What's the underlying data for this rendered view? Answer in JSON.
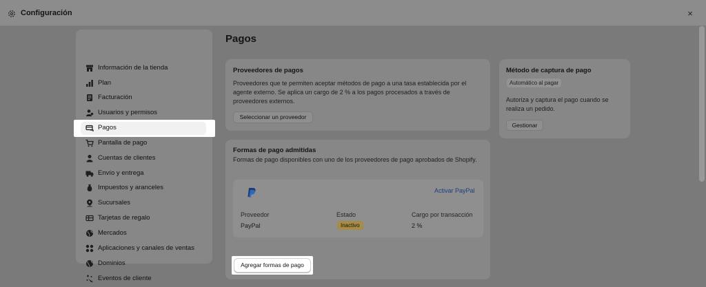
{
  "window": {
    "title": "Configuración",
    "close_glyph": "×"
  },
  "sidebar": {
    "items": [
      {
        "label": "Información de la tienda",
        "icon": "store-icon"
      },
      {
        "label": "Plan",
        "icon": "plan-icon"
      },
      {
        "label": "Facturación",
        "icon": "billing-icon"
      },
      {
        "label": "Usuarios y permisos",
        "icon": "users-icon"
      },
      {
        "label": "Pagos",
        "icon": "payments-icon",
        "active": true
      },
      {
        "label": "Pantalla de pago",
        "icon": "checkout-icon"
      },
      {
        "label": "Cuentas de clientes",
        "icon": "customer-icon"
      },
      {
        "label": "Envío y entrega",
        "icon": "truck-icon"
      },
      {
        "label": "Impuestos y aranceles",
        "icon": "tax-icon"
      },
      {
        "label": "Sucursales",
        "icon": "location-icon"
      },
      {
        "label": "Tarjetas de regalo",
        "icon": "gift-card-icon"
      },
      {
        "label": "Mercados",
        "icon": "globe-icon"
      },
      {
        "label": "Aplicaciones y canales de ventas",
        "icon": "apps-icon"
      },
      {
        "label": "Dominios",
        "icon": "domain-icon"
      },
      {
        "label": "Eventos de cliente",
        "icon": "events-icon"
      }
    ]
  },
  "main": {
    "title": "Pagos",
    "providers": {
      "title": "Proveedores de pagos",
      "description": "Proveedores que te permiten aceptar métodos de pago a una tasa establecida por el agente externo. Se aplica un cargo de 2 % a los pagos procesados a través de proveedores externos.",
      "button": "Seleccionar un proveedor"
    },
    "capture": {
      "title": "Método de captura de pago",
      "badge": "Automático al pagar",
      "description": "Autoriza y captura el pago cuando se realiza un pedido.",
      "button": "Gestionar"
    },
    "methods": {
      "title": "Formas de pago admitidas",
      "description": "Formas de pago disponibles con uno de los proveedores de pago aprobados de Shopify.",
      "activate_link": "Activar PayPal",
      "columns": {
        "provider": "Proveedor",
        "status": "Estado",
        "fee": "Cargo por transacción"
      },
      "row": {
        "provider": "PayPal",
        "status": "Inactivo",
        "fee": "2 %"
      },
      "add_button": "Agregar formas de pago"
    }
  },
  "colors": {
    "paypal_dark": "#1f3a78",
    "paypal_light": "#2e6fc0",
    "inactive_badge": "#a78c48"
  }
}
